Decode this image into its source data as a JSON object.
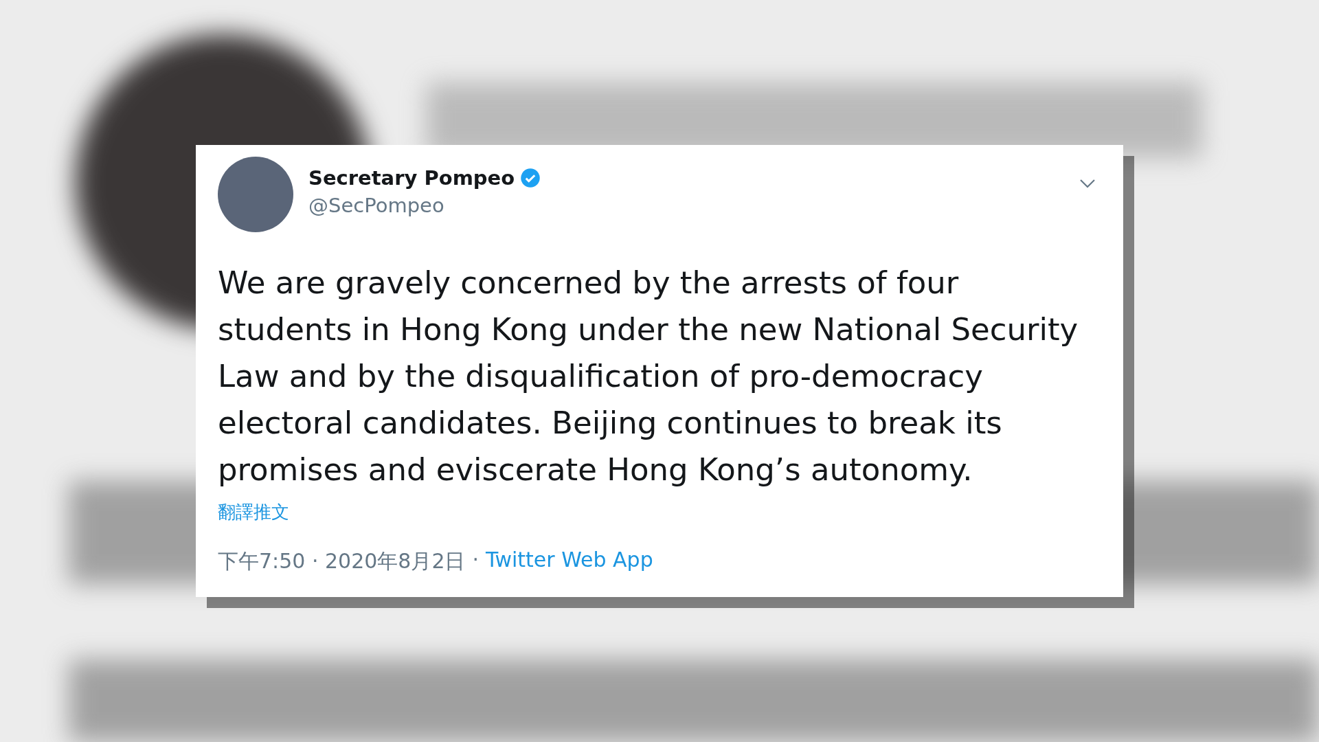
{
  "tweet": {
    "name": "Secretary Pompeo",
    "verified": true,
    "handle": "@SecPompeo",
    "text": "We are gravely concerned by the arrests of four students in Hong Kong under the new National Security Law and by the disqualification of pro-democracy electoral candidates. Beijing continues to break its promises and eviscerate Hong Kong’s autonomy.",
    "translate_link": "翻譯推文",
    "timestamp": "下午7:50 · 2020年8月2日",
    "separator": "·",
    "source": "Twitter Web App"
  }
}
